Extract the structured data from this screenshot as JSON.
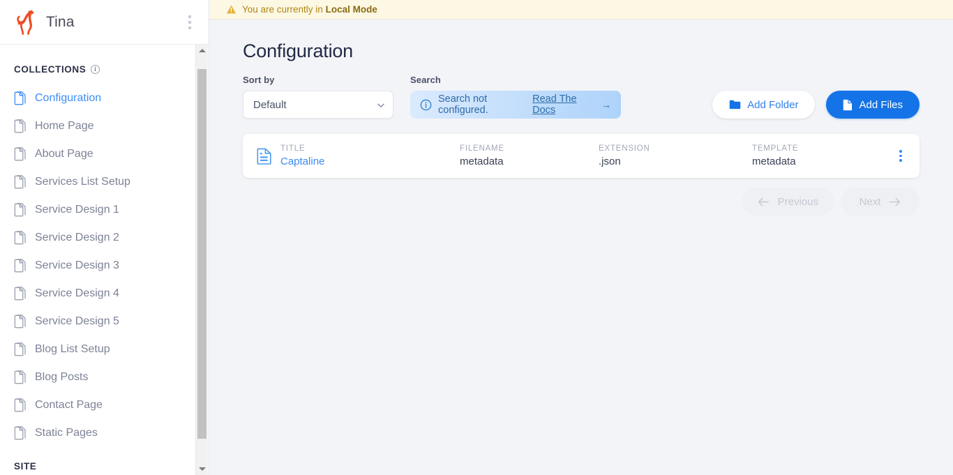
{
  "sidebar": {
    "brand": "Tina",
    "logo_color": "#EC4E27",
    "menu_icon": "kebab-menu-icon",
    "sections": [
      {
        "label": "COLLECTIONS",
        "info_icon": "info-circle-icon",
        "items": [
          {
            "label": "Configuration",
            "icon": "document-icon",
            "active": true
          },
          {
            "label": "Home Page",
            "icon": "document-icon",
            "active": false
          },
          {
            "label": "About Page",
            "icon": "document-icon",
            "active": false
          },
          {
            "label": "Services List Setup",
            "icon": "document-icon",
            "active": false
          },
          {
            "label": "Service Design 1",
            "icon": "document-icon",
            "active": false
          },
          {
            "label": "Service Design 2",
            "icon": "document-icon",
            "active": false
          },
          {
            "label": "Service Design 3",
            "icon": "document-icon",
            "active": false
          },
          {
            "label": "Service Design 4",
            "icon": "document-icon",
            "active": false
          },
          {
            "label": "Service Design 5",
            "icon": "document-icon",
            "active": false
          },
          {
            "label": "Blog List Setup",
            "icon": "document-icon",
            "active": false
          },
          {
            "label": "Blog Posts",
            "icon": "document-icon",
            "active": false
          },
          {
            "label": "Contact Page",
            "icon": "document-icon",
            "active": false
          },
          {
            "label": "Static Pages",
            "icon": "document-icon",
            "active": false
          }
        ]
      },
      {
        "label": "SITE",
        "items": []
      }
    ]
  },
  "banner": {
    "icon": "warning-triangle-icon",
    "text_prefix": "You are currently in ",
    "mode": "Local Mode",
    "background": "#FDF8E3",
    "text_color": "#B08516"
  },
  "page": {
    "title": "Configuration"
  },
  "toolbar": {
    "sort_label": "Sort by",
    "sort_value": "Default",
    "sort_icon": "chevron-down-icon",
    "search_label": "Search",
    "search_notice_icon": "info-circle-icon",
    "search_notice_text": "Search not configured.",
    "search_docs_link": "Read The Docs",
    "search_docs_arrow": "→",
    "add_folder_label": "Add Folder",
    "add_folder_icon": "folder-icon",
    "add_files_label": "Add Files",
    "add_files_icon": "file-icon",
    "primary_color": "#1473E6"
  },
  "table": {
    "columns": [
      "TITLE",
      "FILENAME",
      "EXTENSION",
      "TEMPLATE"
    ],
    "rows": [
      {
        "icon": "document-lines-icon",
        "title": "Captaline",
        "filename": "metadata",
        "extension": ".json",
        "template": "metadata",
        "menu_icon": "kebab-menu-icon"
      }
    ]
  },
  "pagination": {
    "previous_label": "Previous",
    "previous_icon": "arrow-left-icon",
    "next_label": "Next",
    "next_icon": "arrow-right-icon",
    "previous_disabled": true,
    "next_disabled": true
  }
}
